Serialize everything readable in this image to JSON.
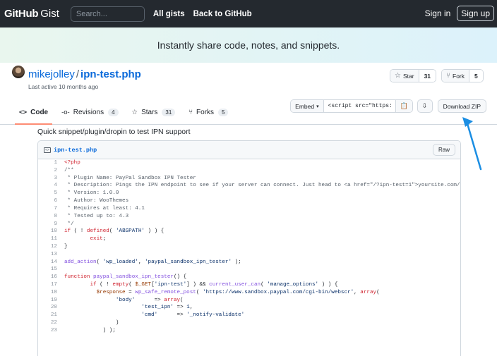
{
  "header": {
    "logo_bold": "GitHub",
    "logo_light": "Gist",
    "search_placeholder": "Search...",
    "links": [
      "All gists",
      "Back to GitHub"
    ],
    "sign_in": "Sign in",
    "sign_up": "Sign up"
  },
  "banner": {
    "text": "Instantly share code, notes, and snippets."
  },
  "gist": {
    "owner": "mikejolley",
    "separator": "/",
    "name": "ipn-test.php",
    "last_active": "Last active 10 months ago",
    "star_label": "Star",
    "star_count": "31",
    "fork_label": "Fork",
    "fork_count": "5"
  },
  "tabs": [
    {
      "label": "Code",
      "icon": "code-icon",
      "active": true
    },
    {
      "label": "Revisions",
      "icon": "revisions-icon",
      "count": "4"
    },
    {
      "label": "Stars",
      "icon": "star-icon",
      "count": "31"
    },
    {
      "label": "Forks",
      "icon": "fork-icon",
      "count": "5"
    }
  ],
  "toolbar": {
    "embed_label": "Embed",
    "embed_value": "<script src=\"https://",
    "download_label": "Download ZIP"
  },
  "description": "Quick snippet/plugin/dropin to test IPN support",
  "file": {
    "name": "ipn-test.php",
    "raw_label": "Raw",
    "lines": [
      "<?php",
      "/**",
      " * Plugin Name: PayPal Sandbox IPN Tester",
      " * Description: Pings the IPN endpoint to see if your server can connect. Just head to <a href=\"/?ipn-test=1\">yoursite.com/?ipn",
      " * Version: 1.0.0",
      " * Author: WooThemes",
      " * Requires at least: 4.1",
      " * Tested up to: 4.3",
      " */",
      "if ( ! defined( 'ABSPATH' ) ) {",
      "        exit;",
      "}",
      "",
      "add_action( 'wp_loaded', 'paypal_sandbox_ipn_tester' );",
      "",
      "function paypal_sandbox_ipn_tester() {",
      "        if ( ! empty( $_GET['ipn-test'] ) && current_user_can( 'manage_options' ) ) {",
      "          $response = wp_safe_remote_post( 'https://www.sandbox.paypal.com/cgi-bin/webscr', array(",
      "                'body'      => array(",
      "                        'test_ipn' => 1,",
      "                        'cmd'      => '_notify-validate'",
      "                )",
      "            ) );"
    ]
  },
  "colors": {
    "header_bg": "#24292f",
    "link": "#0969da",
    "tab_underline": "#fd8c73",
    "annotation_arrow": "#1b8ee3"
  }
}
